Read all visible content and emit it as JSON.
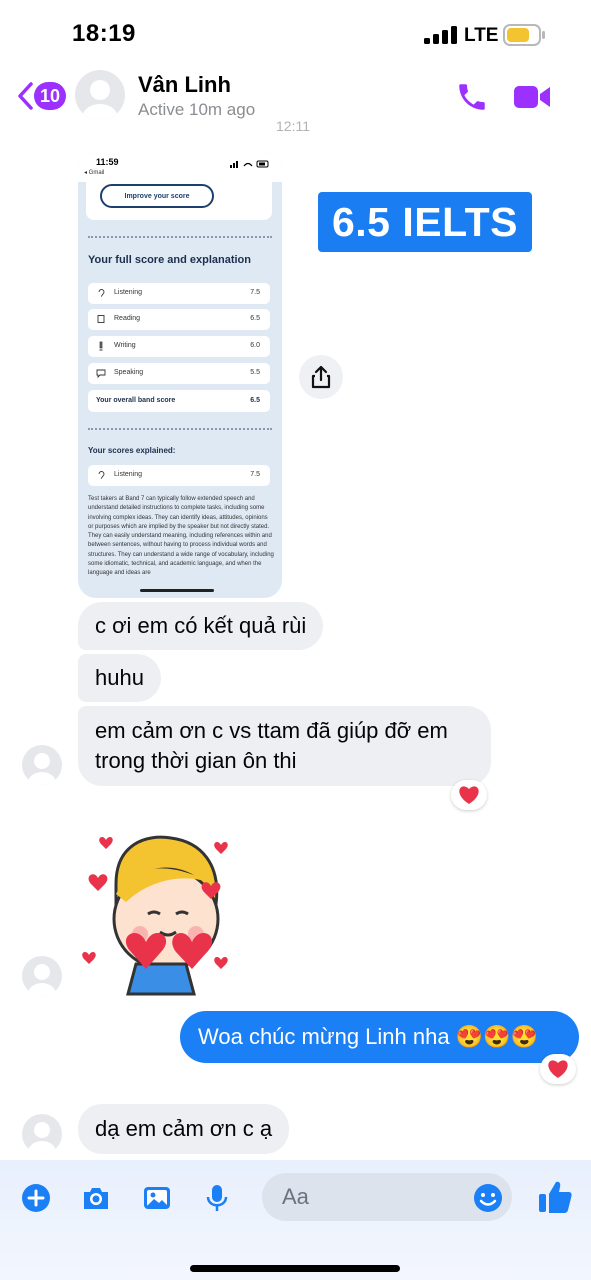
{
  "status_bar": {
    "time": "18:19",
    "network": "LTE"
  },
  "header": {
    "back_count": "10",
    "contact_name": "Vân Linh",
    "contact_status": "Active 10m ago",
    "call_icon": "phone-icon",
    "video_icon": "video-camera-icon"
  },
  "timestamp": "12:11",
  "shared_image": {
    "status_time": "11:59",
    "status_app": "◂ Gmail",
    "improve_button": "Improve your score",
    "section_title": "Your full score and explanation",
    "scores": [
      {
        "label": "Listening",
        "score": "7.5",
        "icon": "ear-icon"
      },
      {
        "label": "Reading",
        "score": "6.5",
        "icon": "book-icon"
      },
      {
        "label": "Writing",
        "score": "6.0",
        "icon": "pen-icon"
      },
      {
        "label": "Speaking",
        "score": "5.5",
        "icon": "speech-bubble-icon"
      }
    ],
    "overall_label": "Your overall band score",
    "overall_score": "6.5",
    "explained_title": "Your scores explained:",
    "explained_row": {
      "label": "Listening",
      "score": "7.5"
    },
    "paragraph": "Test takers at Band 7 can typically follow extended speech and understand detailed instructions to complete tasks, including some involving complex ideas. They can identify ideas, attitudes, opinions or purposes which are implied by the speaker but not directly stated. They can easily understand meaning, including references within and between sentences, without having to process individual words and structures. They can understand a wide range of vocabulary, including some idiomatic, technical, and academic language, and when the language and ideas are"
  },
  "overlay_label": "6.5 IELTS",
  "messages": {
    "m1": "c ơi em có kết quả rùi",
    "m2": "huhu",
    "m3": "em cảm ơn c vs ttam đã giúp đỡ em\ntrong thời gian ôn thi",
    "sent": "Woa chúc mừng Linh nha 😍😍😍",
    "m4": "dạ em cảm ơn c ạ"
  },
  "reactions": {
    "m3": "heart",
    "sent": "heart"
  },
  "composer": {
    "placeholder": "Aa"
  },
  "colors": {
    "accent": "#9b30ff",
    "outgoing": "#1b7ff6",
    "incoming": "#eeeff2",
    "heart": "#e8334a"
  }
}
